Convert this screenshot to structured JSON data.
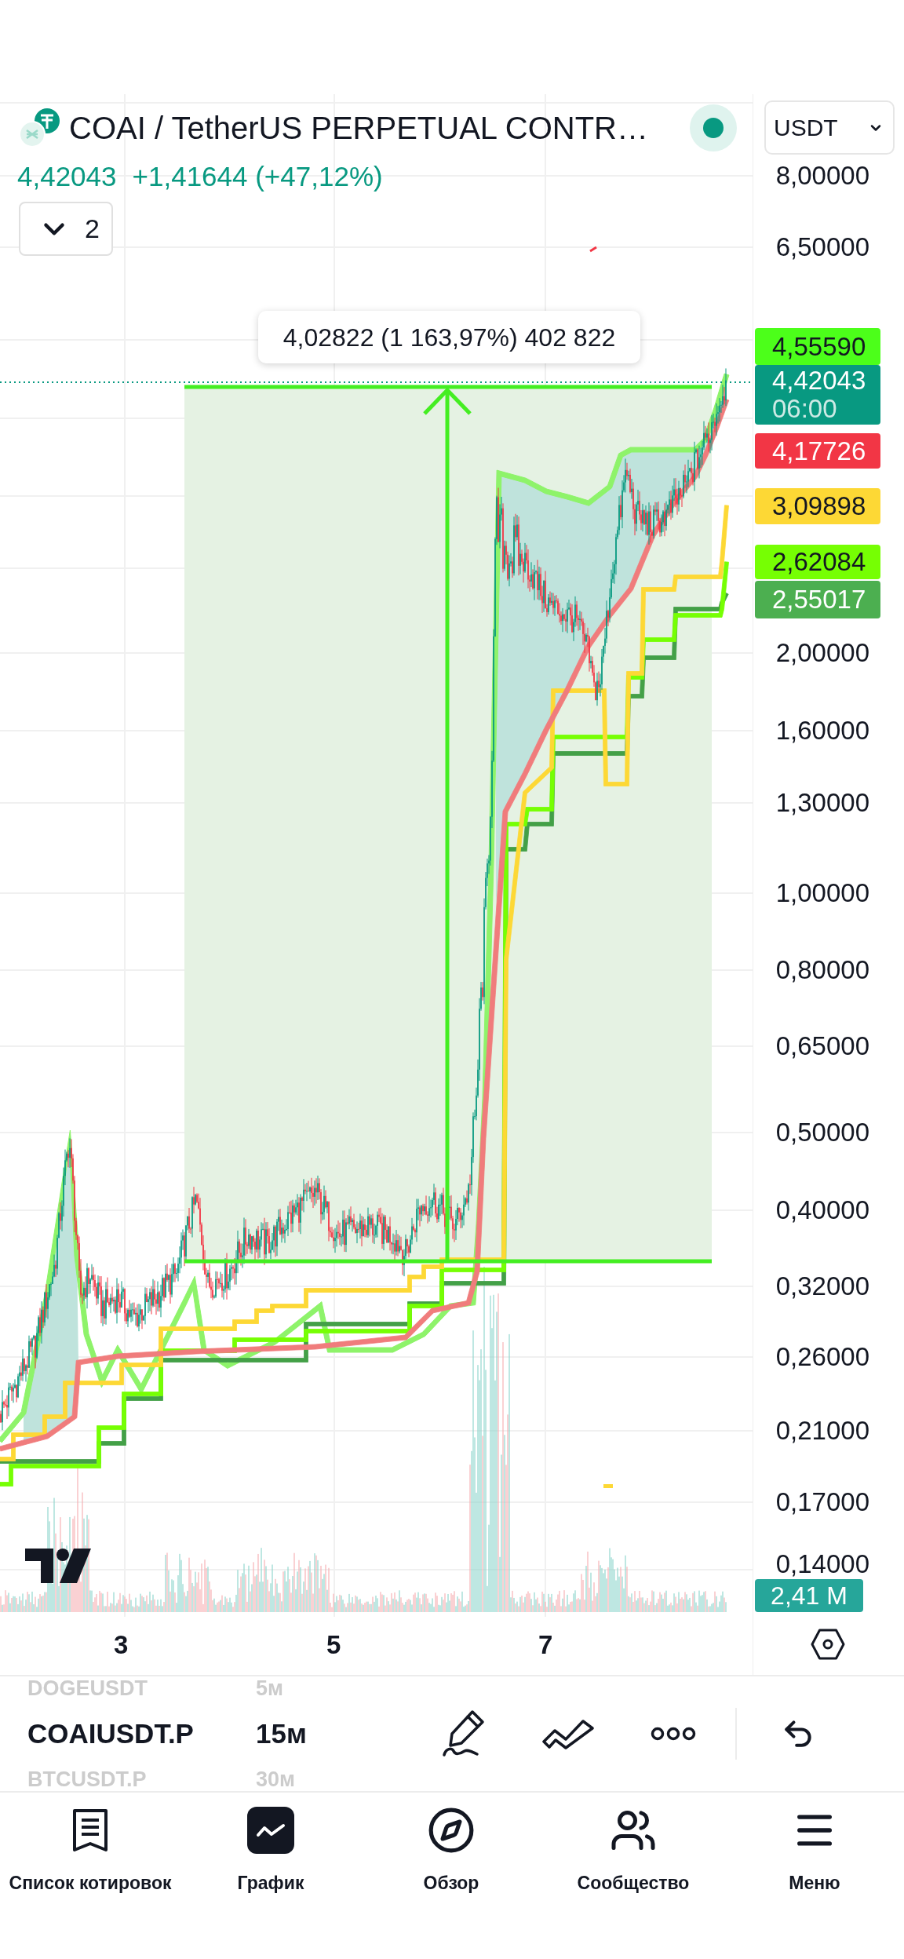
{
  "header": {
    "symbol_title": "COAI / TetherUS PERPETUAL CONTR…",
    "currency": "USDT",
    "last_price": "4,42043",
    "change": "+1,41644 (+47,12%)",
    "indicators_count": "2"
  },
  "chart": {
    "measure_label": "4,02822 (1 163,97%) 402 822",
    "price_tags": [
      {
        "value": "4,55590",
        "color": "#4cff1a"
      },
      {
        "value": "4,42043",
        "countdown": "06:00",
        "color": "#089981"
      },
      {
        "value": "4,17726",
        "color": "#f23645"
      },
      {
        "value": "3,09898",
        "color": "#fdd835"
      },
      {
        "value": "2,62084",
        "color": "#76ff03"
      },
      {
        "value": "2,55017",
        "color": "#4caf50"
      }
    ],
    "price_axis": [
      "8,00000",
      "6,50000",
      "2,00000",
      "1,60000",
      "1,30000",
      "1,00000",
      "0,80000",
      "0,65000",
      "0,50000",
      "0,40000",
      "0,32000",
      "0,26000",
      "0,21000",
      "0,17000",
      "0,14000"
    ],
    "volume_tag": "2,41 M",
    "time_axis": [
      "3",
      "5",
      "7"
    ]
  },
  "toolbar": {
    "symbols": [
      {
        "symbol": "DOGEUSDT",
        "interval": "5м",
        "selected": false
      },
      {
        "symbol": "COAIUSDT.P",
        "interval": "15м",
        "selected": true
      },
      {
        "symbol": "BTCUSDT.P",
        "interval": "30м",
        "selected": false
      }
    ]
  },
  "bottom_nav": [
    {
      "label": "Список котировок",
      "selected": false
    },
    {
      "label": "График",
      "selected": true
    },
    {
      "label": "Обзор",
      "selected": false
    },
    {
      "label": "Сообщество",
      "selected": false
    },
    {
      "label": "Меню",
      "selected": false
    }
  ]
}
